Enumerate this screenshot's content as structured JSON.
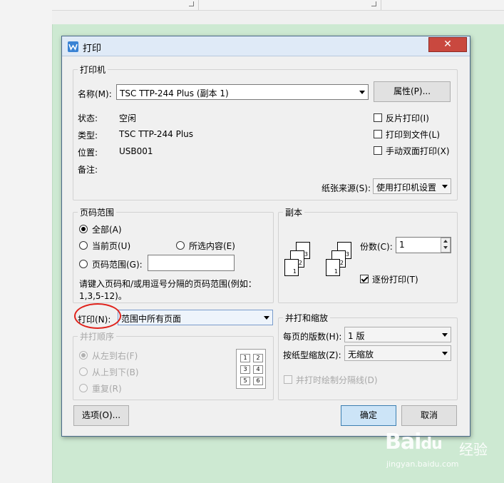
{
  "dialog": {
    "title": "打印",
    "close_glyph": "✕",
    "printer": {
      "legend": "打印机",
      "name_label": "名称(M):",
      "name_value": "TSC TTP-244 Plus (副本 1)",
      "properties_button": "属性(P)...",
      "status_label": "状态:",
      "status_value": "空闲",
      "type_label": "类型:",
      "type_value": "TSC TTP-244 Plus",
      "location_label": "位置:",
      "location_value": "USB001",
      "comment_label": "备注:",
      "comment_value": "",
      "reverse_print": "反片打印(I)",
      "print_to_file": "打印到文件(L)",
      "manual_duplex": "手动双面打印(X)",
      "paper_source_label": "纸张来源(S):",
      "paper_source_value": "使用打印机设置"
    },
    "page_range": {
      "legend": "页码范围",
      "all": "全部(A)",
      "current": "当前页(U)",
      "selection": "所选内容(E)",
      "pages": "页码范围(G):",
      "pages_value": "",
      "hint_line1": "请键入页码和/或用逗号分隔的页码范围(例如：",
      "hint_line2": "1,3,5-12)。",
      "selected": "all"
    },
    "print_what": {
      "label": "打印(N):",
      "value": "范围中所有页面"
    },
    "print_order": {
      "legend": "并打顺序",
      "left_to_right": "从左到右(F)",
      "top_to_bottom": "从上到下(B)",
      "repeat": "重复(R)",
      "grid_numbers": [
        "1",
        "2",
        "3",
        "4",
        "5",
        "6"
      ]
    },
    "copies": {
      "legend": "副本",
      "count_label": "份数(C):",
      "count_value": "1",
      "collate": "逐份打印(T)",
      "collate_checked": true,
      "stack1": [
        "3",
        "2",
        "1"
      ],
      "stack2": [
        "3",
        "2",
        "1"
      ]
    },
    "zoom": {
      "legend": "并打和缩放",
      "pages_per_sheet_label": "每页的版数(H):",
      "pages_per_sheet_value": "1 版",
      "scale_label": "按纸型缩放(Z):",
      "scale_value": "无缩放",
      "draw_borders": "并打时绘制分隔线(D)"
    },
    "options_button": "选项(O)...",
    "ok_button": "确定",
    "cancel_button": "取消"
  },
  "watermark": {
    "brand": "Bai",
    "brand_suffix": "du",
    "cn": "经验",
    "url": "jingyan.baidu.com"
  },
  "colors": {
    "doc_background": "#cde9d2",
    "close_button": "#c9483f",
    "annotation_circle": "#e0221b",
    "primary_button": "#cce4f7"
  }
}
